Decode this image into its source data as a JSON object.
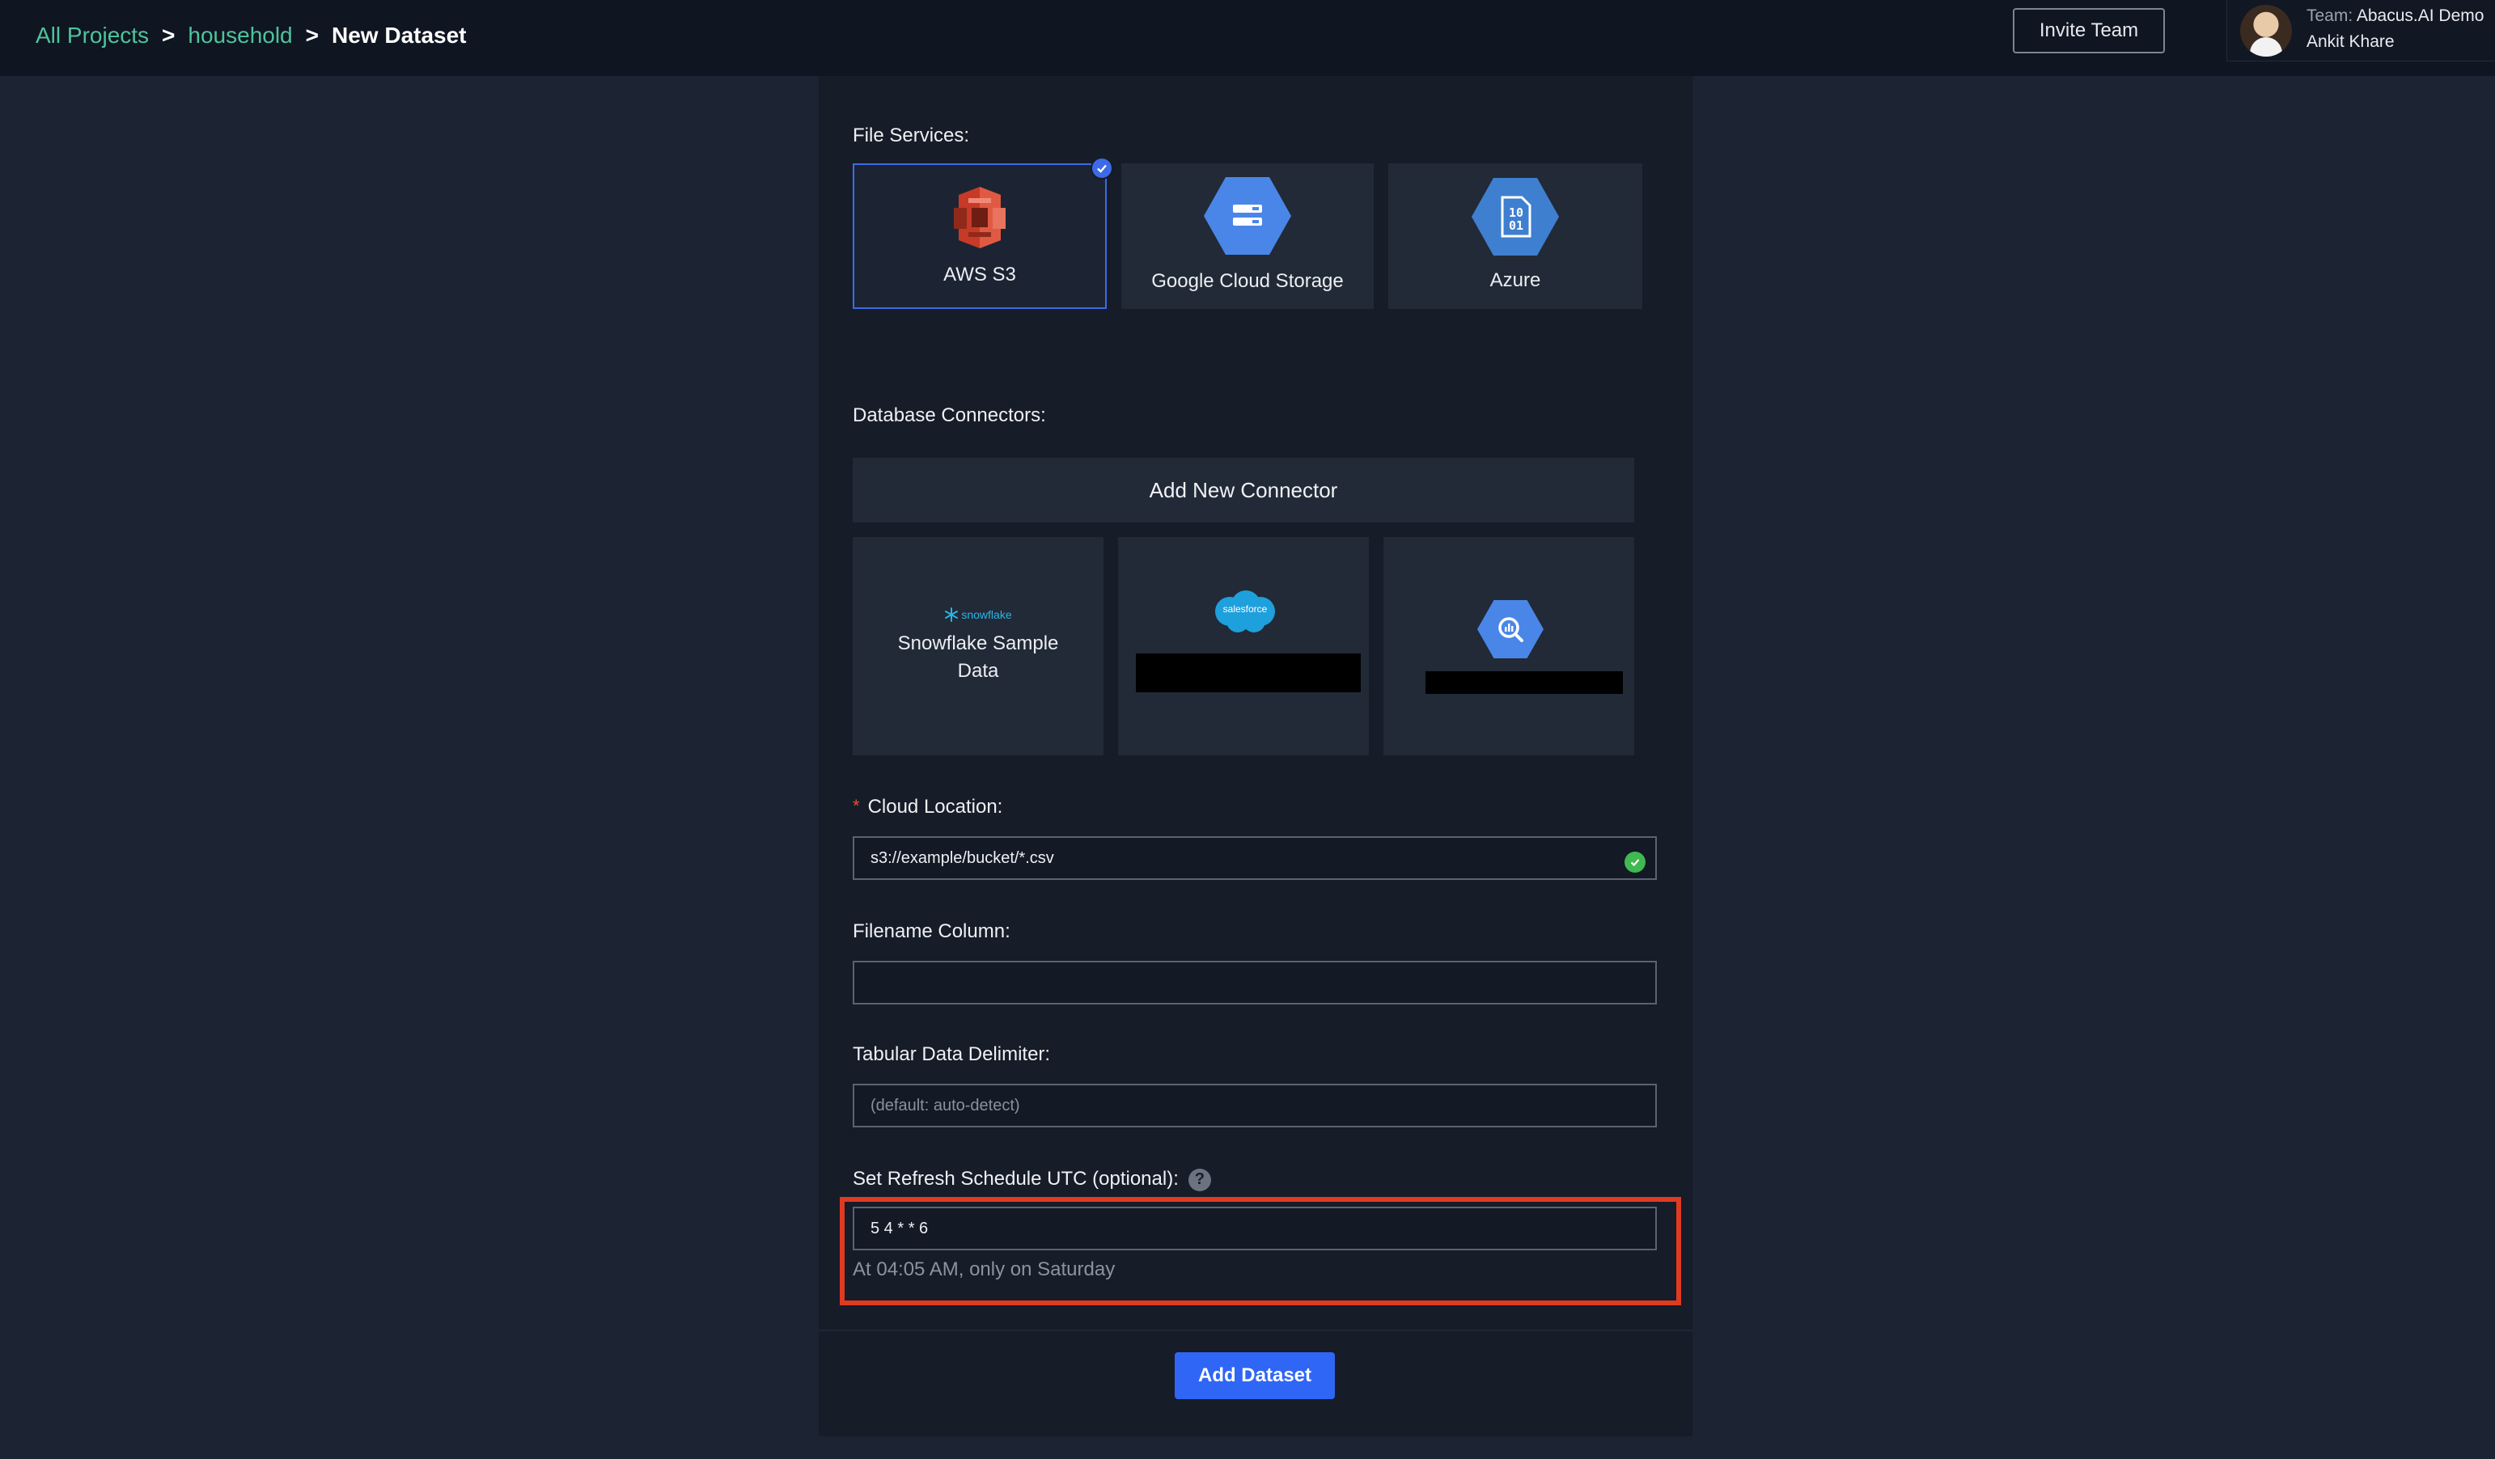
{
  "breadcrumb": {
    "all_projects": "All Projects",
    "separator": ">",
    "project": "household",
    "current": "New Dataset"
  },
  "header": {
    "invite_label": "Invite Team",
    "team_prefix": "Team:",
    "team_name": "Abacus.AI Demo",
    "user_name": "Ankit Khare"
  },
  "file_services": {
    "label": "File Services:",
    "items": [
      {
        "label": "AWS S3",
        "icon": "aws-s3-icon",
        "selected": true
      },
      {
        "label": "Google Cloud Storage",
        "icon": "google-cloud-storage-icon",
        "selected": false
      },
      {
        "label": "Azure",
        "icon": "azure-blob-icon",
        "selected": false
      }
    ]
  },
  "database_connectors": {
    "label": "Database Connectors:",
    "add_label": "Add New Connector",
    "items": [
      {
        "label": "Snowflake Sample Data",
        "logo_text": "snowflake",
        "icon": "snowflake-logo"
      },
      {
        "label": "",
        "logo_text": "salesforce",
        "icon": "salesforce-logo",
        "redacted": true
      },
      {
        "label": "",
        "icon": "bigquery-icon",
        "redacted": true
      }
    ]
  },
  "form": {
    "cloud_location": {
      "label": "Cloud Location:",
      "value": "s3://example/bucket/*.csv",
      "required": true,
      "valid": true
    },
    "filename_column": {
      "label": "Filename Column:",
      "value": ""
    },
    "delimiter": {
      "label": "Tabular Data Delimiter:",
      "placeholder": "(default: auto-detect)"
    },
    "refresh_schedule": {
      "label": "Set Refresh Schedule UTC (optional):",
      "help": "?",
      "value": "5 4 * * 6",
      "description": "At 04:05 AM, only on Saturday"
    }
  },
  "submit_label": "Add Dataset",
  "colors": {
    "accent": "#2f66f5",
    "link": "#4fc49b",
    "highlight": "#e03a20",
    "aws": "#d9412f",
    "gcs": "#4a86e8",
    "azure": "#3f7fd0"
  }
}
